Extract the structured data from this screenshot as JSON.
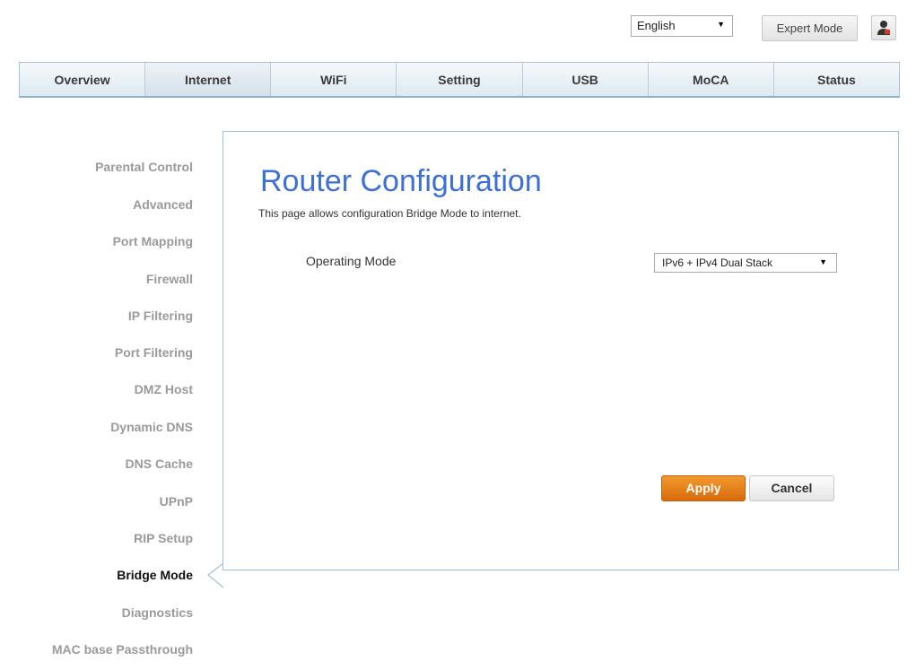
{
  "header": {
    "language": {
      "selected": "English"
    },
    "expert_mode_label": "Expert Mode"
  },
  "tabs": [
    {
      "label": "Overview"
    },
    {
      "label": "Internet",
      "active": true
    },
    {
      "label": "WiFi"
    },
    {
      "label": "Setting"
    },
    {
      "label": "USB"
    },
    {
      "label": "MoCA"
    },
    {
      "label": "Status"
    }
  ],
  "sidebar": {
    "items": [
      {
        "label": "Parental Control"
      },
      {
        "label": "Advanced"
      },
      {
        "label": "Port Mapping"
      },
      {
        "label": "Firewall"
      },
      {
        "label": "IP Filtering"
      },
      {
        "label": "Port Filtering"
      },
      {
        "label": "DMZ Host"
      },
      {
        "label": "Dynamic DNS"
      },
      {
        "label": "DNS Cache"
      },
      {
        "label": "UPnP"
      },
      {
        "label": "RIP Setup"
      },
      {
        "label": "Bridge Mode",
        "active": true
      },
      {
        "label": "Diagnostics"
      },
      {
        "label": "MAC base Passthrough"
      }
    ]
  },
  "main": {
    "title": "Router Configuration",
    "description": "This page allows configuration Bridge Mode to internet.",
    "operating_mode": {
      "label": "Operating Mode",
      "selected": "IPv6 + IPv4 Dual Stack"
    },
    "apply_label": "Apply",
    "cancel_label": "Cancel"
  },
  "colors": {
    "accent_title": "#3d6fd9",
    "apply_button": "#e07a14",
    "panel_border": "#9dc3da"
  }
}
